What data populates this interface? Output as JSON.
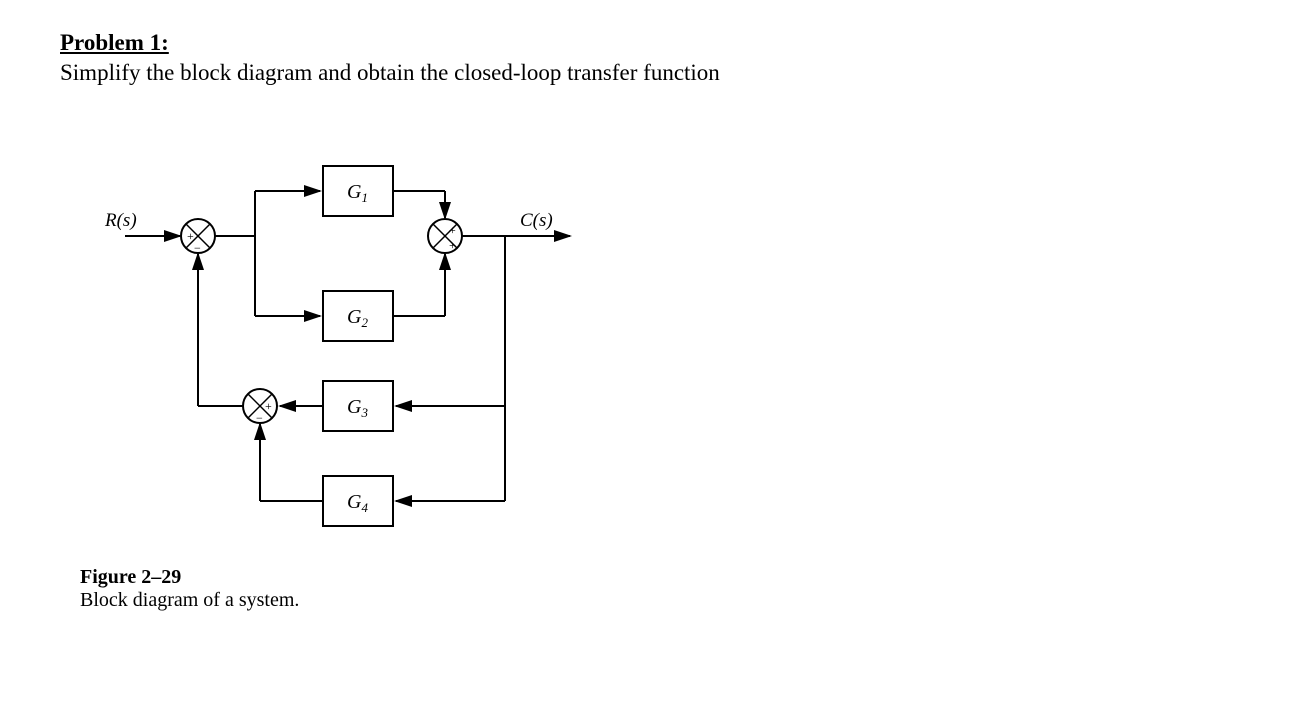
{
  "heading": {
    "title": "Problem 1:"
  },
  "prompt": "Simplify the block diagram and obtain the closed-loop transfer function",
  "diagram": {
    "input_label": "R(s)",
    "output_label": "C(s)",
    "blocks": {
      "g1": "G",
      "g1_sub": "1",
      "g2": "G",
      "g2_sub": "2",
      "g3": "G",
      "g3_sub": "3",
      "g4": "G",
      "g4_sub": "4"
    },
    "summing_junctions": {
      "sj1": {
        "upper_left": "+",
        "lower_left": "−"
      },
      "sj2": {
        "upper_right": "+",
        "lower_right": "+"
      },
      "sj3": {
        "right": "+",
        "lower": "−"
      }
    }
  },
  "caption": {
    "title": "Figure 2–29",
    "text": "Block diagram of a system."
  }
}
